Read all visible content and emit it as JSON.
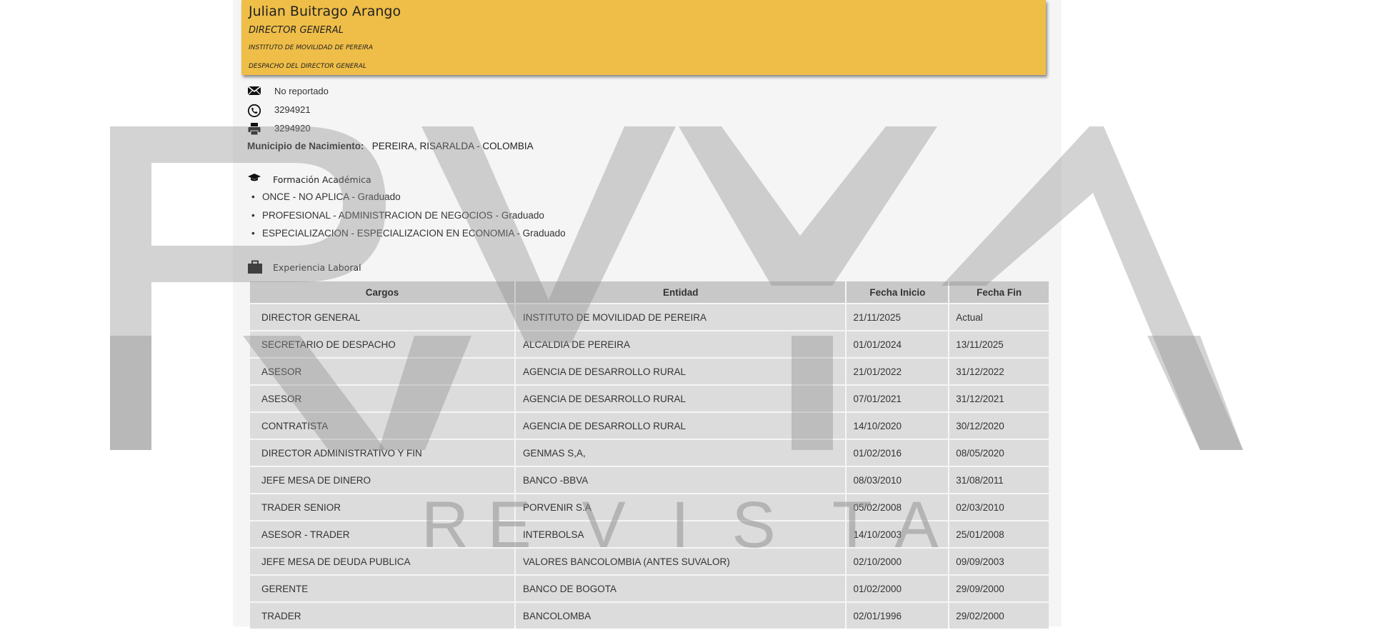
{
  "header": {
    "name": "Julian Buitrago Arango",
    "role": "DIRECTOR GENERAL",
    "organization": "INSTITUTO DE MOVILIDAD DE PEREIRA",
    "department": "DESPACHO DEL DIRECTOR GENERAL",
    "color": "#efbe48"
  },
  "contact": {
    "email": "No reportado",
    "phone": "3294921",
    "fax": "3294920",
    "email_icon": "envelope-icon",
    "phone_icon": "phone-icon",
    "fax_icon": "printer-icon"
  },
  "birthplace": {
    "label": "Municipio de Nacimiento:",
    "value": "PEREIRA, RISARALDA - COLOMBIA"
  },
  "education": {
    "title": "Formación Académica",
    "icon": "graduation-cap-icon",
    "items": [
      {
        "level": "ONCE",
        "program": "NO APLICA",
        "status": "Graduado"
      },
      {
        "level": "PROFESIONAL",
        "program": "ADMINISTRACION DE NEGOCIOS",
        "status": "Graduado"
      },
      {
        "level": "ESPECIALIZACION",
        "program": "ESPECIALIZACION EN ECONOMIA",
        "status": "Graduado"
      }
    ]
  },
  "experience": {
    "title": "Experiencia Laboral",
    "icon": "briefcase-icon",
    "columns": [
      "Cargos",
      "Entidad",
      "Fecha Inicio",
      "Fecha Fin"
    ],
    "rows": [
      [
        "DIRECTOR GENERAL",
        "INSTITUTO DE MOVILIDAD DE PEREIRA",
        "21/11/2025",
        "Actual"
      ],
      [
        "SECRETARIO DE DESPACHO",
        "ALCALDIA DE PEREIRA",
        "01/01/2024",
        "13/11/2025"
      ],
      [
        "ASESOR",
        "AGENCIA DE DESARROLLO RURAL",
        "21/01/2022",
        "31/12/2022"
      ],
      [
        "ASESOR",
        "AGENCIA DE DESARROLLO RURAL",
        "07/01/2021",
        "31/12/2021"
      ],
      [
        "CONTRATISTA",
        "AGENCIA DE DESARROLLO RURAL",
        "14/10/2020",
        "30/12/2020"
      ],
      [
        "DIRECTOR ADMINISTRATIVO Y FIN",
        "GENMAS S,A,",
        "01/02/2016",
        "08/05/2020"
      ],
      [
        "JEFE MESA DE DINERO",
        "BANCO -BBVA",
        "08/03/2010",
        "31/08/2011"
      ],
      [
        "TRADER SENIOR",
        "PORVENIR S.A",
        "05/02/2008",
        "02/03/2010"
      ],
      [
        "ASESOR - TRADER",
        "INTERBOLSA",
        "14/10/2003",
        "25/01/2008"
      ],
      [
        "JEFE MESA DE DEUDA PUBLICA",
        "VALORES BANCOLOMBIA (ANTES SUVALOR)",
        "02/10/2000",
        "09/09/2003"
      ],
      [
        "GERENTE",
        "BANCO DE BOGOTA",
        "01/02/2000",
        "29/09/2000"
      ],
      [
        "TRADER",
        "BANCOLOMBA",
        "02/01/1996",
        "29/02/2000"
      ]
    ]
  },
  "watermark": {
    "subtitle_letters": [
      "R",
      "E",
      "V",
      "I",
      "S",
      "T",
      "A"
    ],
    "color": "#999999"
  }
}
